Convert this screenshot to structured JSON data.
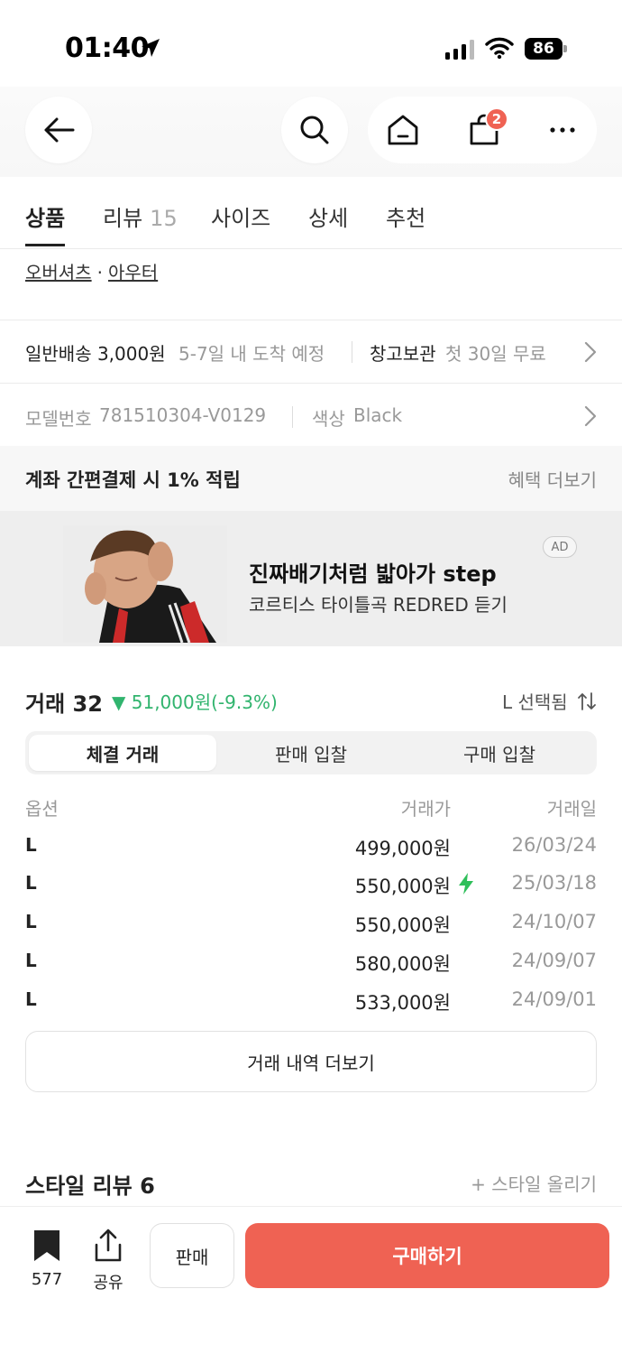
{
  "status_bar": {
    "time": "01:40",
    "battery": "86"
  },
  "header": {
    "cart_badge": "2"
  },
  "tabs": [
    {
      "label": "상품",
      "count": ""
    },
    {
      "label": "리뷰",
      "count": "15"
    },
    {
      "label": "사이즈",
      "count": ""
    },
    {
      "label": "상세",
      "count": ""
    },
    {
      "label": "추천",
      "count": ""
    }
  ],
  "category": {
    "primary": "오버셔츠",
    "separator": "·",
    "secondary": "아우터"
  },
  "shipping": {
    "label": "일반배송 3,000원",
    "eta": "5-7일 내 도착 예정",
    "storage_label": "창고보관",
    "storage_value": "첫 30일 무료"
  },
  "model": {
    "label": "모델번호",
    "number": "781510304-V0129",
    "color_label": "색상",
    "color_value": "Black"
  },
  "benefit": {
    "title": "계좌 간편결제 시 1% 적립",
    "more": "혜택 더보기"
  },
  "ad": {
    "title": "진짜배기처럼 밟아가 step",
    "subtitle": "코르티스 타이틀곡 REDRED 듣기",
    "badge": "AD"
  },
  "trade": {
    "title": "거래 32",
    "change_arrow": "▼",
    "change": "51,000원(-9.3%)",
    "selected": "L 선택됨",
    "segments": [
      "체결 거래",
      "판매 입찰",
      "구매 입찰"
    ],
    "columns": {
      "option": "옵션",
      "price": "거래가",
      "date": "거래일"
    },
    "rows": [
      {
        "option": "L",
        "price": "499,000원",
        "date": "26/03/24"
      },
      {
        "option": "L",
        "price": "550,000원",
        "date": "25/03/18"
      },
      {
        "option": "L",
        "price": "550,000원",
        "date": "24/10/07"
      },
      {
        "option": "L",
        "price": "580,000원",
        "date": "24/09/07"
      },
      {
        "option": "L",
        "price": "533,000원",
        "date": "24/09/01"
      }
    ],
    "more_button": "거래 내역 더보기"
  },
  "style_review": {
    "title": "스타일 리뷰 6",
    "upload": "+ 스타일 올리기"
  },
  "bottom_bar": {
    "bookmark_count": "577",
    "share_label": "공유",
    "sell_label": "판매",
    "buy_label": "구매하기"
  },
  "colors": {
    "accent": "#ef6253",
    "down": "#31b46e",
    "bolt": "#2fbf5a"
  },
  "icons": [
    "location-arrow-icon",
    "signal-icon",
    "wifi-icon",
    "back-arrow-icon",
    "search-icon",
    "home-icon",
    "shopping-bag-icon",
    "more-icon",
    "chevron-right-icon",
    "lightning-icon",
    "sort-icon",
    "bookmark-icon",
    "share-icon"
  ]
}
